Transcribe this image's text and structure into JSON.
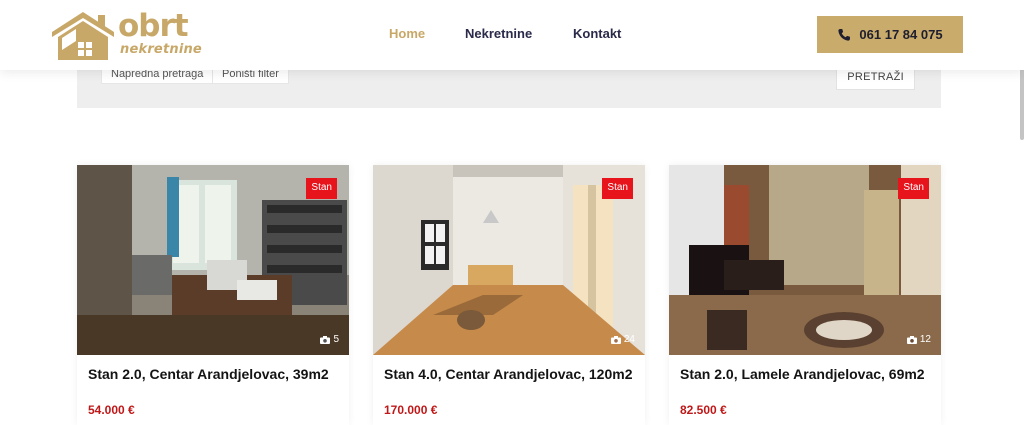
{
  "header": {
    "logo": {
      "word": "obrt",
      "sub": "nekretnine",
      "icon": "house-icon"
    },
    "nav": [
      {
        "label": "Home",
        "active": true
      },
      {
        "label": "Nekretnine",
        "active": false
      },
      {
        "label": "Kontakt",
        "active": false
      }
    ],
    "phone": {
      "icon": "phone-icon",
      "number": "061 17 84 075"
    }
  },
  "search": {
    "advanced_label": "Napredna pretraga",
    "reset_label": "Poništi filter",
    "search_label": "PRETRAŽI"
  },
  "listings": [
    {
      "type": "Stan",
      "photos": "5",
      "title": "Stan 2.0, Centar Arandjelovac, 39m2",
      "price": "54.000 €"
    },
    {
      "type": "Stan",
      "photos": "24",
      "title": "Stan 4.0, Centar Arandjelovac, 120m2",
      "price": "170.000 €"
    },
    {
      "type": "Stan",
      "photos": "12",
      "title": "Stan 2.0, Lamele Arandjelovac, 69m2",
      "price": "82.500 €"
    }
  ],
  "colors": {
    "brand_gold": "#c8a868",
    "price_red": "#c01818",
    "badge_red": "#e8141c",
    "nav_dark": "#2a2a4a"
  }
}
